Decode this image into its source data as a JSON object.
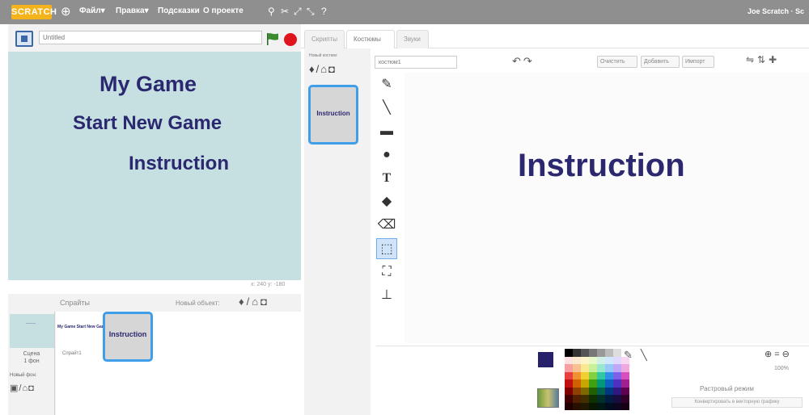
{
  "menubar": {
    "logo": "SCRATCH",
    "items": [
      "Файл▾",
      "Правка▾",
      "Подсказки",
      "О проекте"
    ],
    "user": "Joe Scratch · Sc"
  },
  "stage": {
    "project_title_placeholder": "Untitled",
    "texts": [
      "My Game",
      "Start New Game",
      "Instruction"
    ],
    "coords": "x: 240  y: -180"
  },
  "sprites": {
    "header": "Спрайты",
    "new_object_label": "Новый объект:",
    "new_object_icons": "♦/⌂◘",
    "stage_label": "Сцена\n1 фон",
    "new_backdrop_label": "Новый фон:",
    "backdrop_icons": "▣/⌂◘",
    "sprite1_thumb_text": "My Game Start New Game",
    "sprite1_label": "Спрайт1",
    "sprite2_thumb_text": "Instruction"
  },
  "tabs": [
    "Скрипты",
    "Костюмы",
    "Звуки"
  ],
  "active_tab": "Костюмы",
  "costumes": {
    "new_costume_label": "Новый костюм:",
    "new_costume_icons": "♦/⌂◘",
    "costume1_text": "Instruction"
  },
  "editor": {
    "costume_name": "костюм1",
    "undo_redo": "↶↷",
    "clear_label": "Очистить",
    "add_label": "Добавить",
    "import_label": "Импорт",
    "canvas_text": "Instruction",
    "zoom_level": "100%",
    "raster_mode_label": "Растровый режим",
    "convert_label": "Конвертировать в векторную графику"
  },
  "colors": {
    "selected": "#27206b",
    "stage_bg": "#c6e0e2",
    "text": "#2b2870",
    "highlight": "#3f9ee8"
  }
}
